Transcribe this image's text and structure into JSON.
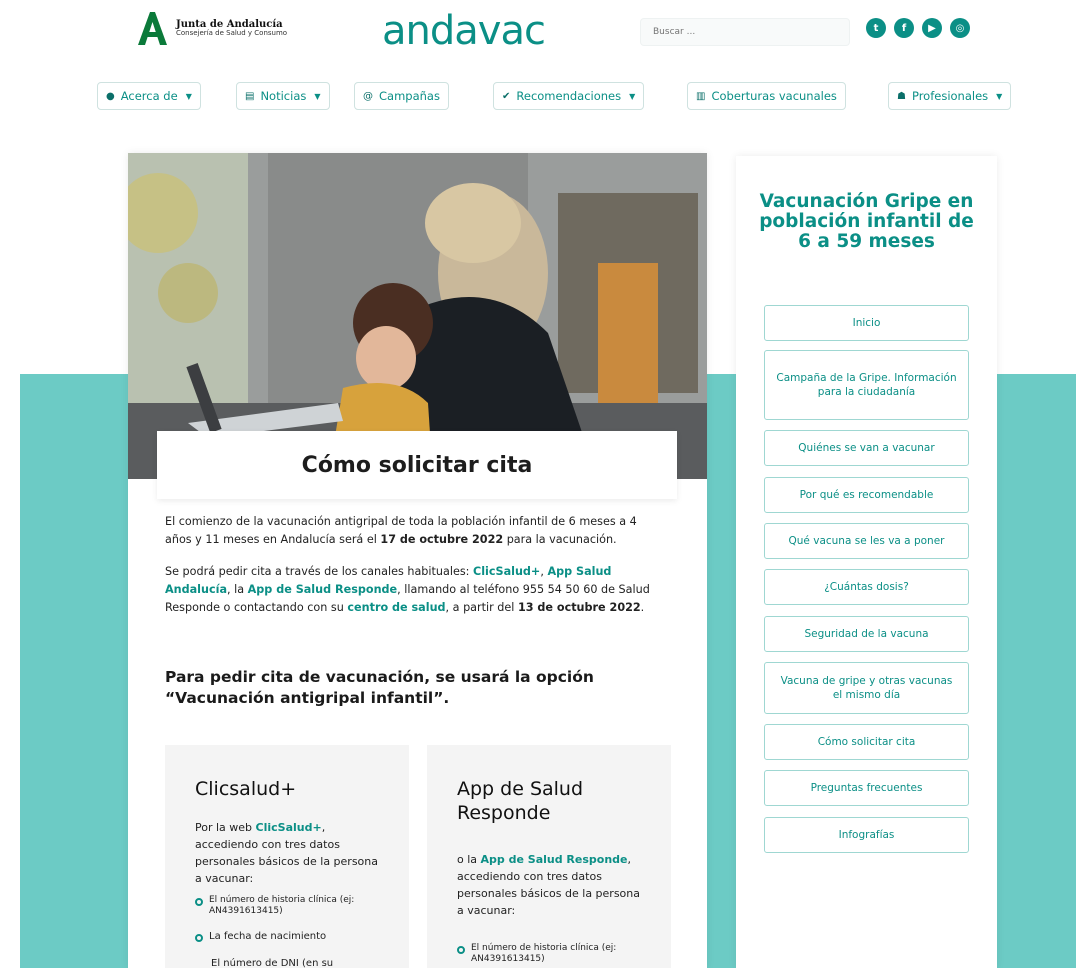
{
  "header": {
    "logo_line1": "Junta de Andalucía",
    "logo_line2": "Consejería de Salud y Consumo",
    "brand": "andavac",
    "search_placeholder": "Buscar ...",
    "socials": [
      "twitter-icon",
      "facebook-icon",
      "youtube-icon",
      "instagram-icon"
    ]
  },
  "nav": [
    {
      "label": "Acerca de",
      "icon": "info-icon",
      "dropdown": true
    },
    {
      "label": "Noticias",
      "icon": "newspaper-icon",
      "dropdown": true
    },
    {
      "label": "Campañas",
      "icon": "at-icon",
      "dropdown": false
    },
    {
      "label": "Recomendaciones",
      "icon": "check-icon",
      "dropdown": true
    },
    {
      "label": "Coberturas vacunales",
      "icon": "chart-icon",
      "dropdown": false
    },
    {
      "label": "Profesionales",
      "icon": "users-icon",
      "dropdown": true
    }
  ],
  "main": {
    "title": "Cómo solicitar cita",
    "p1_a": "El comienzo de la vacunación antigripal de toda la población infantil de 6 meses a 4 años y 11 meses en Andalucía será el ",
    "p1_b": "17 de octubre 2022",
    "p1_c": " para la vacunación.",
    "p2_a": "Se podrá pedir cita a través de los canales habituales: ",
    "p2_link1": "ClicSalud+",
    "p2_sep1": ", ",
    "p2_link2": "App Salud Andalucía",
    "p2_b": ", la ",
    "p2_link3": "App de Salud Responde",
    "p2_c": ", llamando al teléfono 955 54 50 60 de Salud Responde o contactando con su ",
    "p2_link4": "centro de salud",
    "p2_d": ", a partir del ",
    "p2_date": "13 de octubre 2022",
    "p2_e": ".",
    "subhead": "Para pedir cita de vacunación, se usará la opción “Vacunación antigripal infantil”.",
    "card1": {
      "title": "Clicsalud+",
      "text_a": "Por la web ",
      "link": "ClicSalud+",
      "text_b": ", accediendo con tres datos personales básicos de la persona a vacunar:",
      "bullets": [
        "El número de historia clínica (ej: AN4391613415)",
        "La fecha de nacimiento"
      ],
      "trailing": "El número de DNI (en su"
    },
    "card2": {
      "title": "App de Salud Responde",
      "text_a": "o la ",
      "link": "App de Salud Responde",
      "text_b": ", accediendo con tres datos personales básicos de la persona a vacunar:",
      "bullets": [
        "El número de historia clínica (ej: AN4391613415)"
      ]
    }
  },
  "sidebar": {
    "title": "Vacunación Gripe en población infantil de 6 a 59 meses",
    "items": [
      "Inicio",
      "Campaña de la Gripe. Información para la ciudadanía",
      "Quiénes se van a vacunar",
      "Por qué es recomendable",
      "Qué vacuna se les va a poner",
      "¿Cuántas dosis?",
      "Seguridad de la vacuna",
      "Vacuna de gripe y otras vacunas el mismo día",
      "Cómo solicitar cita",
      "Preguntas frecuentes",
      "Infografías"
    ]
  },
  "colors": {
    "accent": "#0b8f86",
    "band": "#6ccbc5"
  }
}
